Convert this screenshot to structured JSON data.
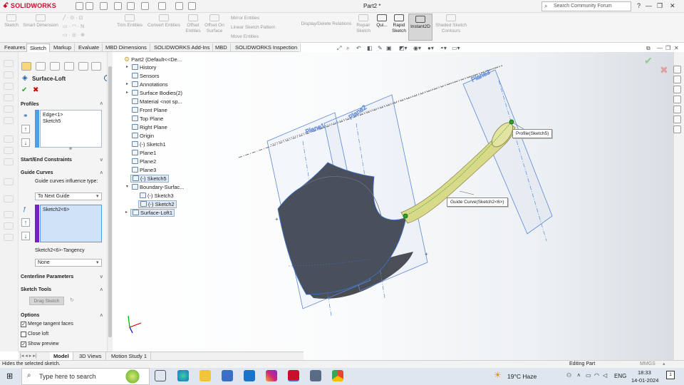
{
  "titlebar": {
    "brand": "SOLIDWORKS",
    "document_title": "Part2 *",
    "search_placeholder": "Search Community Forum",
    "help": "?"
  },
  "command_manager": {
    "commands": [
      {
        "label": "Sketch",
        "enabled": false
      },
      {
        "label": "Smart Dimension",
        "enabled": false
      },
      {
        "label": "Trim Entities",
        "enabled": false
      },
      {
        "label": "Convert Entities",
        "enabled": false
      },
      {
        "label": "Offset Entities",
        "enabled": false
      },
      {
        "label": "Offset On Surface",
        "enabled": false
      },
      {
        "label": "Display/Delete Relations",
        "enabled": false
      },
      {
        "label": "Repair Sketch",
        "enabled": false
      },
      {
        "label": "Qui...",
        "enabled": true
      },
      {
        "label": "Rapid Sketch",
        "enabled": true
      },
      {
        "label": "Instant2D",
        "enabled": true
      },
      {
        "label": "Shaded Sketch Contours",
        "enabled": false
      }
    ],
    "row_items": [
      "Mirror Entities",
      "Linear Sketch Pattern",
      "Move Entities"
    ]
  },
  "tabs": [
    "Features",
    "Sketch",
    "Markup",
    "Evaluate",
    "MBD Dimensions",
    "SOLIDWORKS Add-Ins",
    "MBD",
    "SOLIDWORKS Inspection"
  ],
  "active_tab": "Sketch",
  "property_manager": {
    "title": "Surface-Loft",
    "help": "?",
    "ok": "✔",
    "cancel": "✖",
    "profiles": {
      "title": "Profiles",
      "items": [
        "Edge<1>",
        "Sketch5"
      ]
    },
    "start_end": {
      "title": "Start/End Constraints"
    },
    "guide_curves": {
      "title": "Guide Curves",
      "influence_label": "Guide curves influence type:",
      "influence_value": "To Next Guide",
      "items": [
        "Sketch2<6>"
      ],
      "tangency_label": "Sketch2<6>-Tangency",
      "tangency_value": "None"
    },
    "centerline": {
      "title": "Centerline Parameters"
    },
    "sketch_tools": {
      "title": "Sketch Tools",
      "drag_sketch": "Drag Sketch"
    },
    "options": {
      "title": "Options",
      "merge_tangent": {
        "label": "Merge tangent faces",
        "checked": true
      },
      "close_loft": {
        "label": "Close loft",
        "checked": false
      },
      "show_preview": {
        "label": "Show preview",
        "checked": true
      }
    }
  },
  "feature_tree": {
    "root": "Part2  (Default<<De...",
    "items": [
      {
        "label": "History"
      },
      {
        "label": "Sensors"
      },
      {
        "label": "Annotations"
      },
      {
        "label": "Surface Bodies(2)"
      },
      {
        "label": "Material <not sp..."
      },
      {
        "label": "Front Plane"
      },
      {
        "label": "Top Plane"
      },
      {
        "label": "Right Plane"
      },
      {
        "label": "Origin"
      },
      {
        "label": "(-) Sketch1"
      },
      {
        "label": "Plane1"
      },
      {
        "label": "Plane2"
      },
      {
        "label": "Plane3"
      },
      {
        "label": "(-) Sketch5"
      },
      {
        "label": "Boundary-Surfac..."
      },
      {
        "label": "(-) Sketch3"
      },
      {
        "label": "(-) Sketch2"
      },
      {
        "label": "Surface-Loft1"
      }
    ]
  },
  "viewport": {
    "callouts": {
      "profile": "Profile(Sketch5)",
      "guide": "Guide Curve(Sketch2<6>)"
    },
    "plane_labels": [
      "Plane1",
      "Plane2",
      "Plane3"
    ],
    "colors": {
      "loft_preview": "#d9d98a",
      "surface": "#4a4f5c",
      "plane": "#5b86d6",
      "handle": "#2aa52a"
    }
  },
  "bottom_tabs": [
    "Model",
    "3D Views",
    "Motion Study 1"
  ],
  "active_bottom_tab": "Model",
  "statusbar": {
    "message": "Hides the selected sketch.",
    "mode": "Editing Part",
    "units": "MMGS"
  },
  "taskbar": {
    "search_placeholder": "Type here to search",
    "weather": "19°C  Haze",
    "language": "ENG",
    "time": "18:33",
    "date": "14-01-2024",
    "notifications": "1"
  }
}
